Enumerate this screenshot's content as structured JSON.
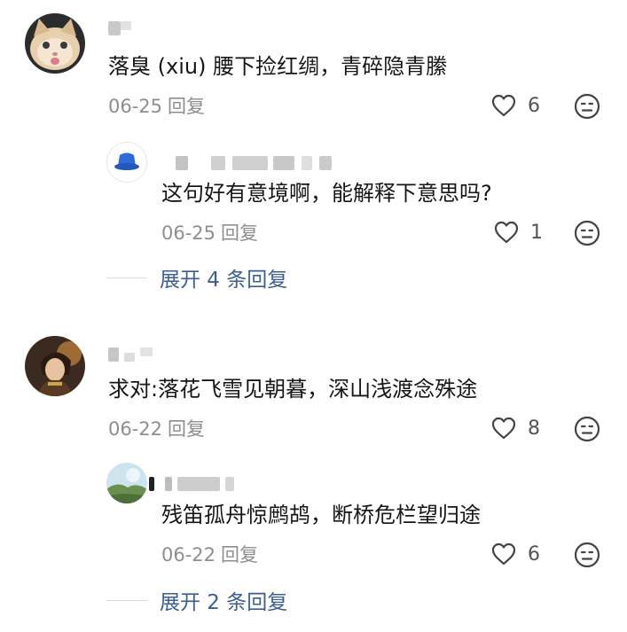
{
  "comments": [
    {
      "text": "落臭 (xiu) 腰下捡红绸，青碎隐青縢",
      "date": "06-25",
      "reply_label": "回复",
      "likes": "6",
      "reply": {
        "text": "这句好有意境啊，能解释下意思吗?",
        "date": "06-25",
        "reply_label": "回复",
        "likes": "1"
      },
      "expand_label": "展开 4 条回复"
    },
    {
      "text": "求对:落花飞雪见朝暮，深山浅渡念殊途",
      "date": "06-22",
      "reply_label": "回复",
      "likes": "8",
      "reply": {
        "text": "残笛孤舟惊鹧鸪，断桥危栏望归途",
        "date": "06-22",
        "reply_label": "回复",
        "likes": "6"
      },
      "expand_label": "展开 2 条回复"
    }
  ],
  "icons": {
    "like": "heart-outline-icon",
    "dislike": "neutral-face-icon"
  },
  "colors": {
    "text": "#161616",
    "meta": "#8e8e8e",
    "expand_link": "#3b5f8f",
    "icon_stroke": "#444444"
  }
}
